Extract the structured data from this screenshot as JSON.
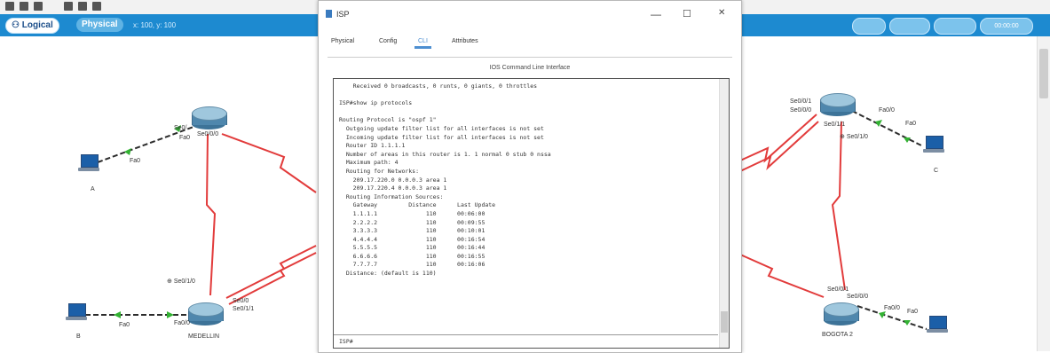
{
  "toolbar": {
    "icons": [
      "zoom-icon",
      "zoom-out-icon",
      "grid-icon",
      "custom-shape-icon",
      "draw-icon",
      "resize-icon"
    ]
  },
  "mode_bar": {
    "logical_label": "Logical",
    "physical_label": "Physical",
    "extra_text": "x: 100, y: 100",
    "right_text": "00:00:00"
  },
  "topology": {
    "devices": {
      "pc_a": "A",
      "pc_b": "B",
      "pc_c": "C",
      "router_medellin": "MEDELLIN",
      "router_bogota2": "BOGOTA 2"
    },
    "ports": {
      "r1_se00": "Se0/0/0",
      "r1_se0_alt": "Se0/",
      "r1_fa0": "Fa0",
      "pca_fa0": "Fa0",
      "med_se010": "Se0/1/0",
      "med_se011": "Se0/1/1",
      "med_se0": "Se0/0",
      "med_fa00": "Fa0/0",
      "pcb_fa0": "Fa0",
      "r3_se001": "Se0/0/1",
      "r3_se000": "Se0/0/0",
      "r3_se011": "Se0/1/1",
      "r3_fa00": "Fa0/0",
      "r3_se010": "Se0/1/0",
      "pcc_fa0": "Fa0",
      "b2_se001": "Se0/0/1",
      "b2_se000": "Se0/0/0",
      "b2_fa00": "Fa0/0",
      "b2_fa0": "Fa0"
    },
    "colors": {
      "serial_link": "#e23b3b",
      "ethernet_link": "#2c2c2c",
      "link_light": "#33b233"
    }
  },
  "dialog": {
    "title": "ISP",
    "minimize": "—",
    "maximize": "☐",
    "close": "✕",
    "tabs": {
      "physical": "Physical",
      "config": "Config",
      "cli": "CLI",
      "attributes": "Attributes"
    },
    "cli_header": "IOS Command Line Interface",
    "cli_lines": [
      "    Received 0 broadcasts, 0 runts, 0 giants, 0 throttles",
      "",
      "ISP#show ip protocols",
      "",
      "Routing Protocol is \"ospf 1\"",
      "  Outgoing update filter list for all interfaces is not set",
      "  Incoming update filter list for all interfaces is not set",
      "  Router ID 1.1.1.1",
      "  Number of areas in this router is 1. 1 normal 0 stub 0 nssa",
      "  Maximum path: 4",
      "  Routing for Networks:",
      "    209.17.220.0 0.0.0.3 area 1",
      "    209.17.220.4 0.0.0.3 area 1",
      "  Routing Information Sources:",
      "    Gateway         Distance      Last Update",
      "    1.1.1.1              110      00:06:00",
      "    2.2.2.2              110      00:09:55",
      "    3.3.3.3              110      00:10:01",
      "    4.4.4.4              110      00:16:54",
      "    5.5.5.5              110      00:16:44",
      "    6.6.6.6              110      00:16:55",
      "    7.7.7.7              110      00:16:06",
      "  Distance: (default is 110)"
    ],
    "cli_prompt": "ISP#"
  }
}
